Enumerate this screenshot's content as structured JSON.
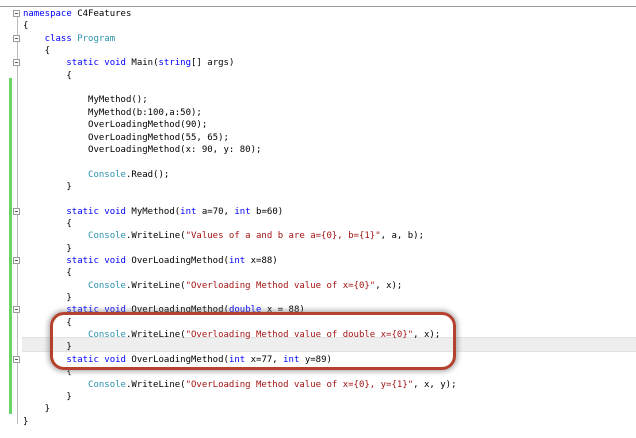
{
  "code_lines": [
    {
      "indent": 0,
      "tokens": [
        [
          "kw",
          "namespace"
        ],
        [
          "pl",
          " C4Features"
        ]
      ]
    },
    {
      "indent": 0,
      "tokens": [
        [
          "pl",
          "{"
        ]
      ]
    },
    {
      "indent": 1,
      "tokens": [
        [
          "kw",
          "class"
        ],
        [
          "pl",
          " "
        ],
        [
          "ty",
          "Program"
        ]
      ]
    },
    {
      "indent": 1,
      "tokens": [
        [
          "pl",
          "{"
        ]
      ]
    },
    {
      "indent": 2,
      "tokens": [
        [
          "kw",
          "static"
        ],
        [
          "pl",
          " "
        ],
        [
          "kw",
          "void"
        ],
        [
          "pl",
          " Main("
        ],
        [
          "kw",
          "string"
        ],
        [
          "pl",
          "[] args)"
        ]
      ]
    },
    {
      "indent": 2,
      "tokens": [
        [
          "pl",
          "{"
        ]
      ]
    },
    {
      "indent": 0,
      "tokens": []
    },
    {
      "indent": 3,
      "tokens": [
        [
          "pl",
          "MyMethod();"
        ]
      ]
    },
    {
      "indent": 3,
      "tokens": [
        [
          "pl",
          "MyMethod(b:100,a:50);"
        ]
      ]
    },
    {
      "indent": 3,
      "tokens": [
        [
          "pl",
          "OverLoadingMethod(90);"
        ]
      ]
    },
    {
      "indent": 3,
      "tokens": [
        [
          "pl",
          "OverLoadingMethod(55, 65);"
        ]
      ]
    },
    {
      "indent": 3,
      "tokens": [
        [
          "pl",
          "OverLoadingMethod(x: 90, y: 80);"
        ]
      ]
    },
    {
      "indent": 0,
      "tokens": []
    },
    {
      "indent": 3,
      "tokens": [
        [
          "ty",
          "Console"
        ],
        [
          "pl",
          ".Read();"
        ]
      ]
    },
    {
      "indent": 2,
      "tokens": [
        [
          "pl",
          "}"
        ]
      ]
    },
    {
      "indent": 0,
      "tokens": []
    },
    {
      "indent": 2,
      "tokens": [
        [
          "kw",
          "static"
        ],
        [
          "pl",
          " "
        ],
        [
          "kw",
          "void"
        ],
        [
          "pl",
          " MyMethod("
        ],
        [
          "kw",
          "int"
        ],
        [
          "pl",
          " a=70, "
        ],
        [
          "kw",
          "int"
        ],
        [
          "pl",
          " b=60)"
        ]
      ]
    },
    {
      "indent": 2,
      "tokens": [
        [
          "pl",
          "{"
        ]
      ]
    },
    {
      "indent": 3,
      "tokens": [
        [
          "ty",
          "Console"
        ],
        [
          "pl",
          ".WriteLine("
        ],
        [
          "st",
          "\"Values of a and b are a={0}, b={1}\""
        ],
        [
          "pl",
          ", a, b);"
        ]
      ]
    },
    {
      "indent": 2,
      "tokens": [
        [
          "pl",
          "}"
        ]
      ]
    },
    {
      "indent": 2,
      "tokens": [
        [
          "kw",
          "static"
        ],
        [
          "pl",
          " "
        ],
        [
          "kw",
          "void"
        ],
        [
          "pl",
          " OverLoadingMethod("
        ],
        [
          "kw",
          "int"
        ],
        [
          "pl",
          " x=88)"
        ]
      ]
    },
    {
      "indent": 2,
      "tokens": [
        [
          "pl",
          "{"
        ]
      ]
    },
    {
      "indent": 3,
      "tokens": [
        [
          "ty",
          "Console"
        ],
        [
          "pl",
          ".WriteLine("
        ],
        [
          "st",
          "\"Overloading Method value of x={0}\""
        ],
        [
          "pl",
          ", x);"
        ]
      ]
    },
    {
      "indent": 2,
      "tokens": [
        [
          "pl",
          "}"
        ]
      ]
    },
    {
      "indent": 2,
      "tokens": [
        [
          "kw",
          "static"
        ],
        [
          "pl",
          " "
        ],
        [
          "kw",
          "void"
        ],
        [
          "pl",
          " OverLoadingMethod("
        ],
        [
          "kw",
          "double"
        ],
        [
          "pl",
          " x = 88)"
        ]
      ]
    },
    {
      "indent": 2,
      "tokens": [
        [
          "pl",
          "{"
        ]
      ]
    },
    {
      "indent": 3,
      "tokens": [
        [
          "ty",
          "Console"
        ],
        [
          "pl",
          ".WriteLine("
        ],
        [
          "st",
          "\"Overloading Method value of double x={0}\""
        ],
        [
          "pl",
          ", x);"
        ]
      ]
    },
    {
      "indent": 2,
      "tokens": [
        [
          "pl",
          "}"
        ]
      ]
    },
    {
      "indent": 2,
      "tokens": [
        [
          "kw",
          "static"
        ],
        [
          "pl",
          " "
        ],
        [
          "kw",
          "void"
        ],
        [
          "pl",
          " OverLoadingMethod("
        ],
        [
          "kw",
          "int"
        ],
        [
          "pl",
          " x=77, "
        ],
        [
          "kw",
          "int"
        ],
        [
          "pl",
          " y=89)"
        ]
      ]
    },
    {
      "indent": 2,
      "tokens": [
        [
          "pl",
          "{"
        ]
      ]
    },
    {
      "indent": 3,
      "tokens": [
        [
          "ty",
          "Console"
        ],
        [
          "pl",
          ".WriteLine("
        ],
        [
          "st",
          "\"OverLoading Method value of x={0}, y={1}\""
        ],
        [
          "pl",
          ", x, y);"
        ]
      ]
    },
    {
      "indent": 2,
      "tokens": [
        [
          "pl",
          "}"
        ]
      ]
    },
    {
      "indent": 1,
      "tokens": [
        [
          "pl",
          "}"
        ]
      ]
    },
    {
      "indent": 0,
      "tokens": [
        [
          "pl",
          "}"
        ]
      ]
    }
  ],
  "fold_lines": [
    0,
    2,
    4,
    16,
    20,
    24,
    28
  ],
  "colors": {
    "keyword": "#0000ff",
    "type": "#2b91af",
    "string": "#a31515",
    "highlight_border": "#b5412f",
    "changed_bar": "#6ad36a"
  }
}
